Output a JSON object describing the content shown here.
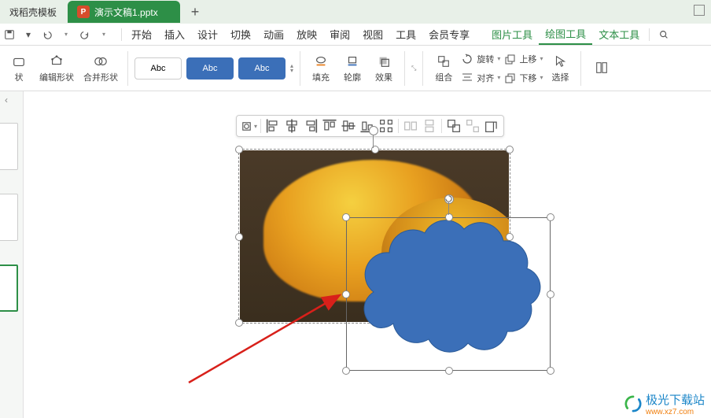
{
  "tabs": {
    "inactive_label": "戏稻壳模板",
    "active_label": "演示文稿1.pptx",
    "active_icon_letter": "P"
  },
  "menu": {
    "items": [
      "开始",
      "插入",
      "设计",
      "切换",
      "动画",
      "放映",
      "审阅",
      "视图",
      "工具",
      "会员专享"
    ],
    "context_items": [
      "图片工具",
      "绘图工具",
      "文本工具"
    ],
    "active_context": "绘图工具"
  },
  "ribbon": {
    "shape_btn": "状",
    "edit_shape": "编辑形状",
    "merge_shape": "合并形状",
    "style_label": "Abc",
    "fill": "填充",
    "outline": "轮廓",
    "effect": "效果",
    "group": "组合",
    "rotate": "旋转",
    "align": "对齐",
    "grid": "上移",
    "down": "下移",
    "select": "选择"
  },
  "watermark": {
    "text": "极光下载站",
    "url": "www.xz7.com"
  }
}
